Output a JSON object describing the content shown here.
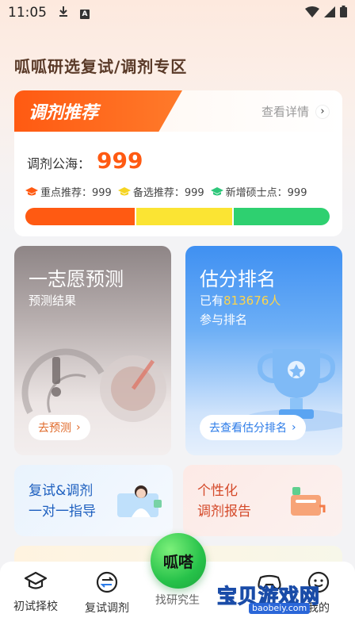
{
  "status_bar": {
    "time": "11:05",
    "icons": [
      "download-icon",
      "a-icon",
      "wifi-icon",
      "signal-icon",
      "battery-icon"
    ]
  },
  "page": {
    "title": "呱呱研选复试/调剂专区"
  },
  "recommend": {
    "tag": "调剂推荐",
    "more_label": "查看详情",
    "sea_label": "调剂公海：",
    "sea_value": "999",
    "stats": [
      {
        "label": "重点推荐：999",
        "color": "#ff5a12"
      },
      {
        "label": "备选推荐：999",
        "color": "#f5d422"
      },
      {
        "label": "新增硕士点：999",
        "color": "#2ec77a"
      }
    ],
    "progress": [
      {
        "fraction": 0.36,
        "color": "#ff5a12"
      },
      {
        "fraction": 0.32,
        "color": "#fbe433"
      },
      {
        "fraction": 0.32,
        "color": "#2ed070"
      }
    ]
  },
  "predict": {
    "title": "一志愿预测",
    "subtitle": "预测结果",
    "button_label": "去预测",
    "button_color": "#e06a2a"
  },
  "rank": {
    "title": "估分排名",
    "sub_prefix": "已有",
    "count": "813676",
    "sub_suffix": "人",
    "sub2": "参与排名",
    "button_label": "去查看估分排名",
    "button_color": "#2b7be8"
  },
  "retest": {
    "line1": "复试&调剂",
    "line2": "一对一指导",
    "color": "#1d5fbf"
  },
  "report": {
    "line1": "个性化",
    "line2": "调剂报告",
    "color": "#d44a2a"
  },
  "tabbar": {
    "items": [
      {
        "label": "初试择校",
        "icon": "graduation-cap-icon"
      },
      {
        "label": "复试调剂",
        "icon": "swap-icon"
      },
      {
        "label": "找研究生",
        "icon": "search-icon"
      },
      {
        "label": "游戏",
        "icon": "gamepad-icon"
      },
      {
        "label": "我的",
        "icon": "user-icon"
      }
    ],
    "center_label": "呱嗒"
  },
  "watermark": {
    "text": "宝贝游戏网",
    "url": "baobeiy.com"
  }
}
